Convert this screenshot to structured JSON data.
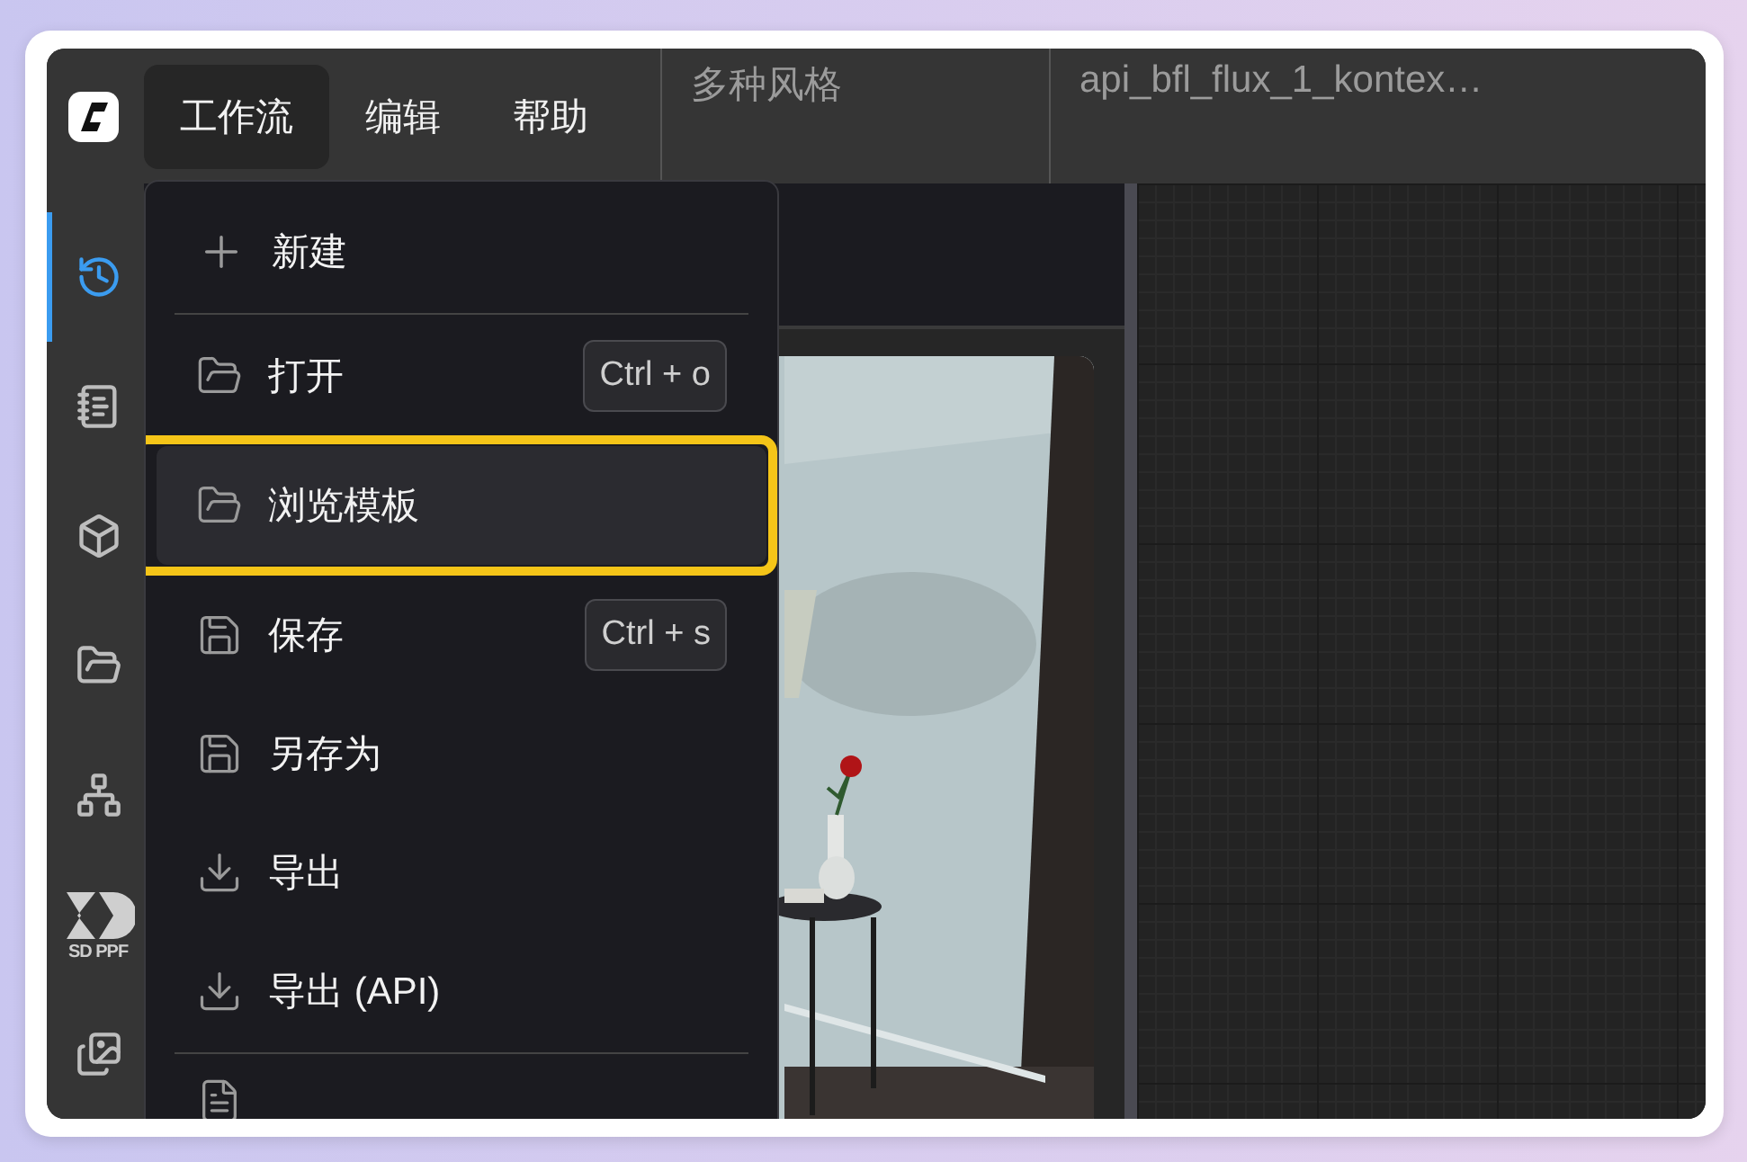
{
  "menubar": [
    {
      "label": "工作流",
      "selected": true
    },
    {
      "label": "编辑",
      "selected": false
    },
    {
      "label": "帮助",
      "selected": false
    }
  ],
  "tabs": [
    {
      "label": "多种风格"
    },
    {
      "label": "api_bfl_flux_1_kontex…"
    }
  ],
  "sidebar": [
    {
      "kind": "history",
      "selected": true
    },
    {
      "kind": "queue",
      "selected": false
    },
    {
      "kind": "models",
      "selected": false
    },
    {
      "kind": "workflows",
      "selected": false
    },
    {
      "kind": "nodes",
      "selected": false
    },
    {
      "kind": "logo",
      "label": "SD PPF",
      "selected": false
    },
    {
      "kind": "gallery",
      "selected": false
    }
  ],
  "menu": [
    {
      "kind": "new",
      "label": "新建",
      "highlighted": false,
      "divider_after": true
    },
    {
      "kind": "open",
      "label": "打开",
      "shortcut": "Ctrl + o",
      "highlighted": false,
      "divider_after": false
    },
    {
      "kind": "open",
      "label": "浏览模板",
      "highlighted": true,
      "divider_after": false
    },
    {
      "kind": "save",
      "label": "保存",
      "shortcut": "Ctrl + s",
      "highlighted": false,
      "divider_after": false
    },
    {
      "kind": "save",
      "label": "另存为",
      "highlighted": false,
      "divider_after": false
    },
    {
      "kind": "export",
      "label": "导出",
      "highlighted": false,
      "divider_after": false
    },
    {
      "kind": "export",
      "label": "导出 (API)",
      "highlighted": false,
      "divider_after": true
    }
  ]
}
